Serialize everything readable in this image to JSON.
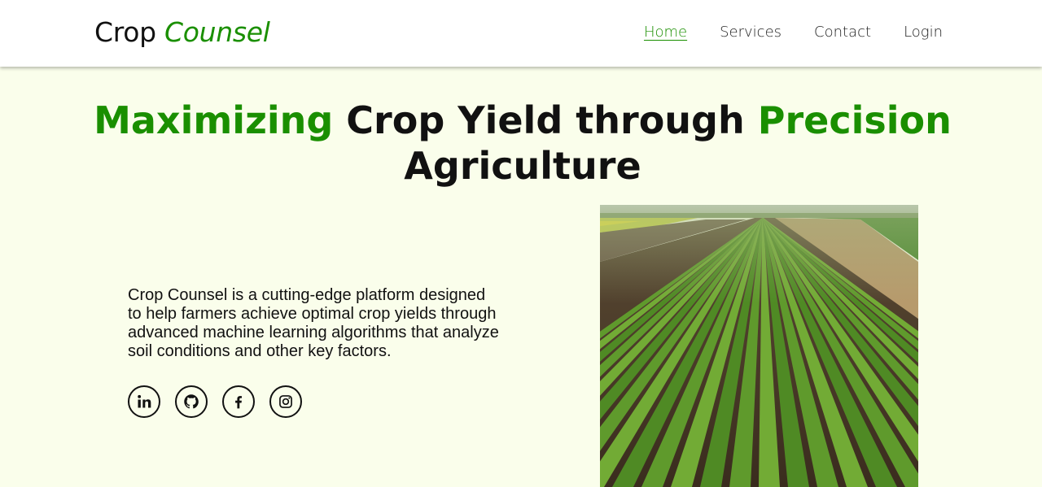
{
  "brand": {
    "part1": "Crop",
    "part2": "Counsel"
  },
  "nav": {
    "home": "Home",
    "services": "Services",
    "contact": "Contact",
    "login": "Login"
  },
  "hero": {
    "title_word1": "Maximizing",
    "title_mid": " Crop Yield through ",
    "title_word2": "Precision",
    "title_end": "Agriculture",
    "description": "Crop Counsel is a cutting-edge platform designed to help farmers achieve optimal crop yields through advanced machine learning algorithms that analyze soil conditions and other key factors."
  },
  "socials": [
    {
      "icon": "linkedin-icon"
    },
    {
      "icon": "github-icon"
    },
    {
      "icon": "facebook-icon"
    },
    {
      "icon": "instagram-icon"
    }
  ],
  "colors": {
    "accent": "#1a8f00",
    "background": "#fafeeb",
    "navbar": "#ffffff",
    "text": "#111111"
  }
}
